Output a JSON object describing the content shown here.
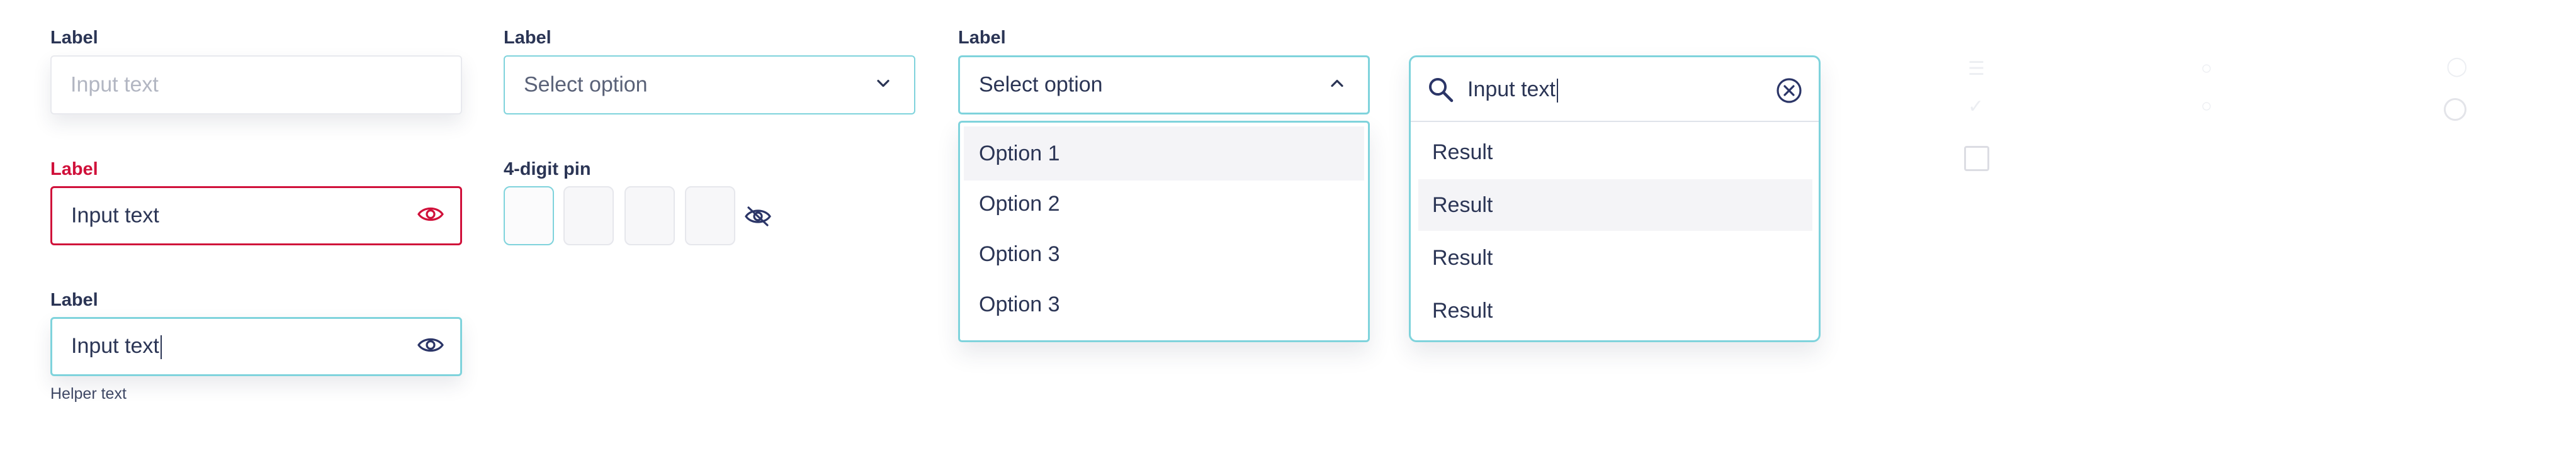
{
  "text_input_default": {
    "label": "Label",
    "placeholder": "Input text"
  },
  "text_input_error": {
    "label": "Label",
    "value": "Input text",
    "icon": "eye-icon",
    "color": "#d0103a"
  },
  "text_input_focused": {
    "label": "Label",
    "value": "Input text",
    "icon": "eye-icon",
    "helper": "Helper text"
  },
  "select_closed": {
    "label": "Label",
    "placeholder": "Select option",
    "icon": "chevron-down-icon"
  },
  "pin_input": {
    "label": "4-digit pin",
    "digits": 4,
    "icon": "eye-off-icon"
  },
  "select_open": {
    "label": "Label",
    "value": "Select option",
    "icon": "chevron-up-icon",
    "options": [
      "Option 1",
      "Option 2",
      "Option 3",
      "Option 3"
    ],
    "highlighted_index": 0
  },
  "search": {
    "value": "Input text",
    "icons": [
      "search-icon",
      "clear-icon"
    ],
    "results": [
      "Result",
      "Result",
      "Result",
      "Result"
    ],
    "highlighted_index": 1
  },
  "colors": {
    "accent": "#7fd3dc",
    "text": "#2b3555",
    "error": "#d0103a"
  }
}
